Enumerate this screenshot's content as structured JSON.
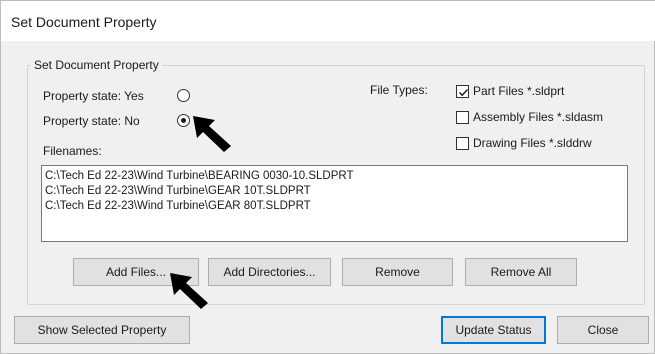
{
  "window": {
    "title": "Set Document Property"
  },
  "group": {
    "legend": "Set Document Property"
  },
  "property_state": {
    "yes_label": "Property state: Yes",
    "no_label": "Property state: No",
    "selected": "no"
  },
  "file_types": {
    "label": "File Types:",
    "options": [
      {
        "label": "Part Files *.sldprt",
        "checked": true
      },
      {
        "label": "Assembly Files *.sldasm",
        "checked": false
      },
      {
        "label": "Drawing Files *.slddrw",
        "checked": false
      }
    ]
  },
  "filenames": {
    "label": "Filenames:",
    "items": [
      "C:\\Tech Ed 22-23\\Wind Turbine\\BEARING 0030-10.SLDPRT",
      "C:\\Tech Ed 22-23\\Wind Turbine\\GEAR 10T.SLDPRT",
      "C:\\Tech Ed 22-23\\Wind Turbine\\GEAR 80T.SLDPRT"
    ]
  },
  "buttons": {
    "add_files": "Add Files...",
    "add_directories": "Add Directories...",
    "remove": "Remove",
    "remove_all": "Remove All",
    "show_selected_property": "Show Selected Property",
    "update_status": "Update Status",
    "close": "Close"
  },
  "colors": {
    "dialog_bg": "#f0f0f0",
    "focus_border": "#0078d7",
    "annotation_arrow": "#000000"
  }
}
